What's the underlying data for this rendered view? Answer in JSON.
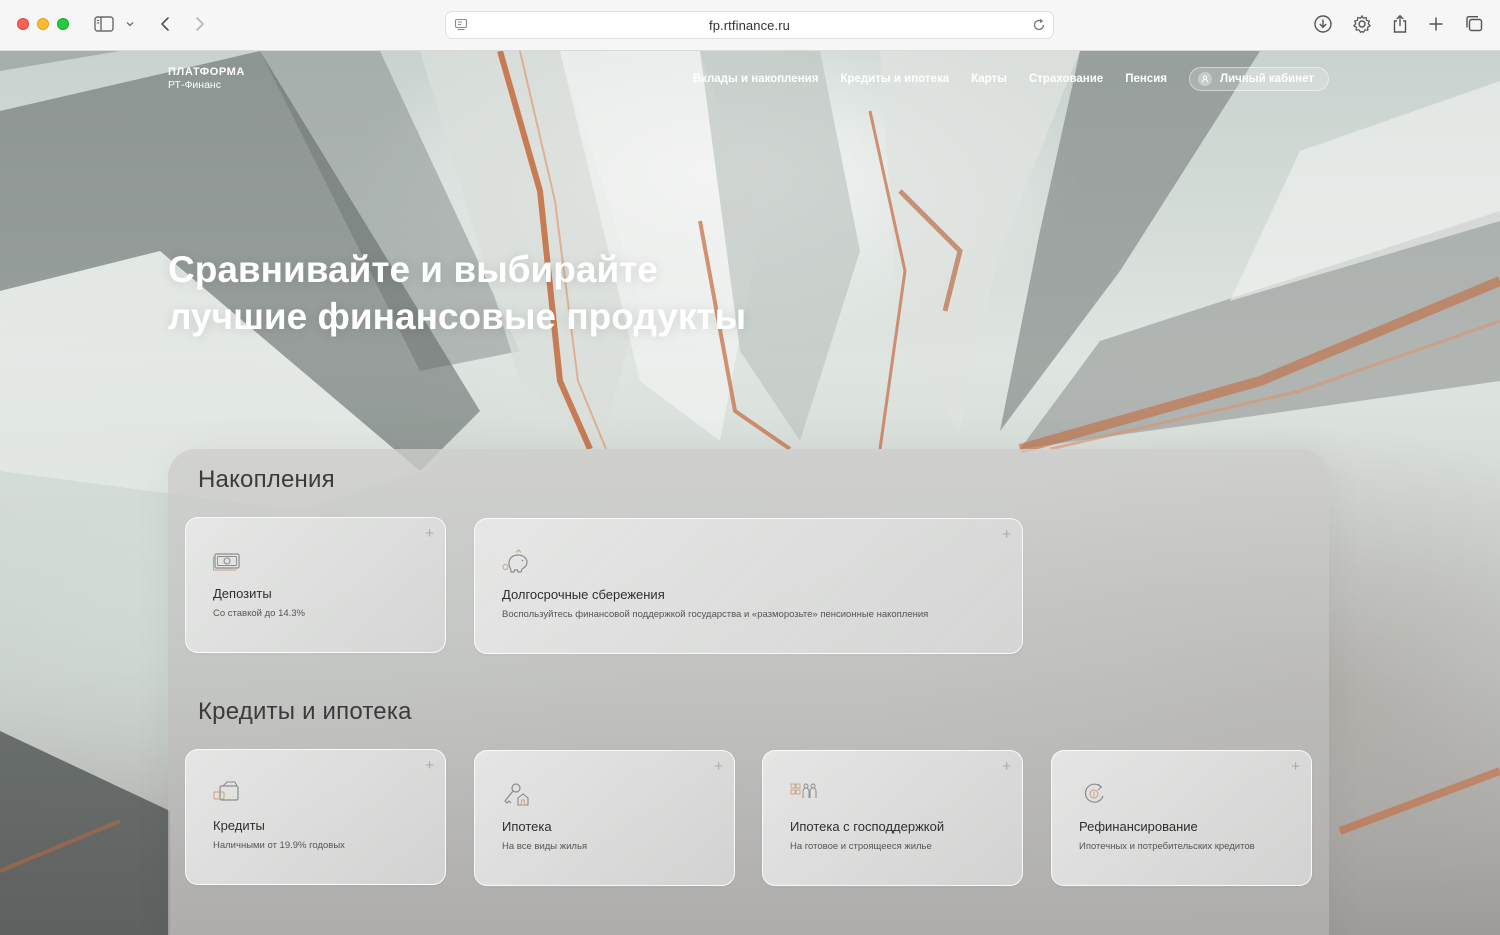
{
  "browser": {
    "url": "fp.rtfinance.ru"
  },
  "header": {
    "logo_main": "ПЛАТФОРМА",
    "logo_sub": "РТ-Финанс",
    "nav": [
      {
        "label": "Вклады и накопления"
      },
      {
        "label": "Кредиты и ипотека"
      },
      {
        "label": "Карты"
      },
      {
        "label": "Страхование"
      },
      {
        "label": "Пенсия"
      }
    ],
    "cabinet_label": "Личный кабинет"
  },
  "hero": {
    "line1": "Сравнивайте и выбирайте",
    "line2": "лучшие финансовые продукты"
  },
  "savings": {
    "title": "Накопления",
    "cards": [
      {
        "title": "Депозиты",
        "subtitle": "Со ставкой до 14.3%",
        "icon": "cash-icon"
      },
      {
        "title": "Долгосрочные сбережения",
        "subtitle": "Воспользуйтесь финансовой поддержкой государства и «разморозьте» пенсионные накопления",
        "icon": "piggy-bank-icon"
      }
    ]
  },
  "loans": {
    "title": "Кредиты и ипотека",
    "cards": [
      {
        "title": "Кредиты",
        "subtitle": "Наличными от 19.9% годовых",
        "icon": "wallet-icon"
      },
      {
        "title": "Ипотека",
        "subtitle": "На все виды жилья",
        "icon": "key-house-icon"
      },
      {
        "title": "Ипотека с господдержкой",
        "subtitle": "На готовое и строящееся жилье",
        "icon": "family-icon"
      },
      {
        "title": "Рефинансирование",
        "subtitle": "Ипотечных и потребительских кредитов",
        "icon": "refresh-coin-icon"
      }
    ]
  },
  "card_plus": "+",
  "colors": {
    "panel": "#c9c9c7",
    "card": "#e3e4e3",
    "accent_copper": "#c46a3c"
  }
}
